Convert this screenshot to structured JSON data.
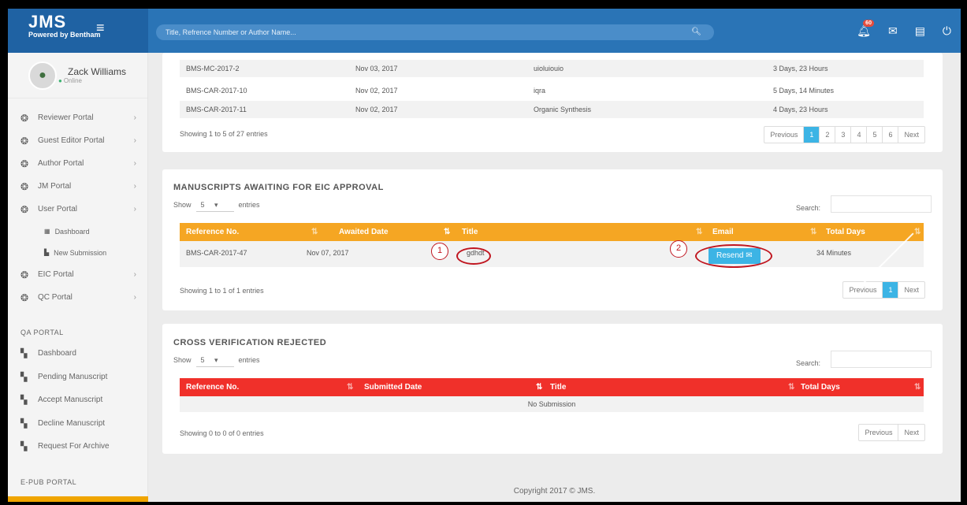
{
  "app": {
    "name": "JMS",
    "tagline": "Powered by Bentham"
  },
  "search": {
    "placeholder": "Title, Refrence Number or Author Name..."
  },
  "topbar": {
    "notification_count": "60"
  },
  "user": {
    "name": "Zack Williams",
    "status": "Online"
  },
  "sidebar": {
    "items": [
      {
        "label": "Reviewer Portal"
      },
      {
        "label": "Guest Editor Portal"
      },
      {
        "label": "Author Portal"
      },
      {
        "label": "JM Portal"
      },
      {
        "label": "User Portal"
      }
    ],
    "user_portal_sub": [
      {
        "label": "Dashboard"
      },
      {
        "label": "New Submission"
      }
    ],
    "items2": [
      {
        "label": "EIC Portal"
      },
      {
        "label": "QC Portal"
      }
    ],
    "qa_title": "QA PORTAL",
    "qa_items": [
      {
        "label": "Dashboard"
      },
      {
        "label": "Pending Manuscript"
      },
      {
        "label": "Accept Manuscript"
      },
      {
        "label": "Decline Manuscript"
      },
      {
        "label": "Request For Archive"
      }
    ],
    "epub_title": "E-PUB PORTAL"
  },
  "panel1": {
    "rows": [
      {
        "ref": "BMS-MC-2017-2",
        "date": "Nov 03, 2017",
        "title": "uioluiouio",
        "days": "3 Days, 23 Hours"
      },
      {
        "ref": "BMS-CAR-2017-10",
        "date": "Nov 02, 2017",
        "title": "iqra",
        "days": "5 Days, 14 Minutes"
      },
      {
        "ref": "BMS-CAR-2017-11",
        "date": "Nov 02, 2017",
        "title": "Organic Synthesis",
        "days": "4 Days, 23 Hours"
      }
    ],
    "showing": "Showing 1 to 5 of 27 entries",
    "pager": [
      "Previous",
      "1",
      "2",
      "3",
      "4",
      "5",
      "6",
      "Next"
    ]
  },
  "panel2": {
    "title": "MANUSCRIPTS AWAITING FOR EIC APPROVAL",
    "show_label": "Show",
    "show_value": "5",
    "entries_label": "entries",
    "search_label": "Search:",
    "headers": {
      "ref": "Reference No.",
      "date": "Awaited Date",
      "title": "Title",
      "email": "Email",
      "days": "Total Days"
    },
    "row": {
      "ref": "BMS-CAR-2017-47",
      "date": "Nov 07, 2017",
      "title": "gdhdt",
      "email_btn": "Resend",
      "days": "34 Minutes"
    },
    "annot": [
      "1",
      "2"
    ],
    "showing": "Showing 1 to 1 of 1 entries",
    "pager": [
      "Previous",
      "1",
      "Next"
    ]
  },
  "panel3": {
    "title": "CROSS VERIFICATION REJECTED",
    "show_label": "Show",
    "show_value": "5",
    "entries_label": "entries",
    "search_label": "Search:",
    "headers": {
      "ref": "Reference No.",
      "date": "Submitted Date",
      "title": "Title",
      "days": "Total Days"
    },
    "empty": "No Submission",
    "showing": "Showing 0 to 0 of 0 entries",
    "pager": [
      "Previous",
      "Next"
    ]
  },
  "footer": "Copyright 2017 © JMS.",
  "colors": {
    "topbar": "#2a74b6",
    "accent": "#3cb4e5",
    "orange": "#f5a623",
    "red": "#f0302a",
    "annotation": "#c0151f"
  }
}
